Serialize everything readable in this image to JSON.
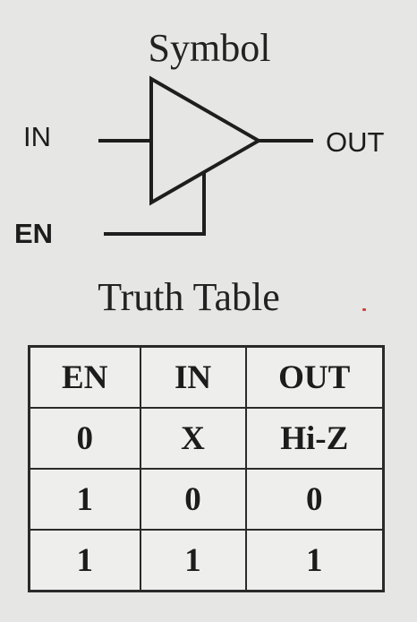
{
  "symbol_title": "Symbol",
  "truth_table_title": "Truth Table",
  "pins": {
    "input": "IN",
    "enable": "EN",
    "output": "OUT"
  },
  "truth_table": {
    "headers": [
      "EN",
      "IN",
      "OUT"
    ],
    "rows": [
      [
        "0",
        "X",
        "Hi-Z"
      ],
      [
        "1",
        "0",
        "0"
      ],
      [
        "1",
        "1",
        "1"
      ]
    ]
  }
}
